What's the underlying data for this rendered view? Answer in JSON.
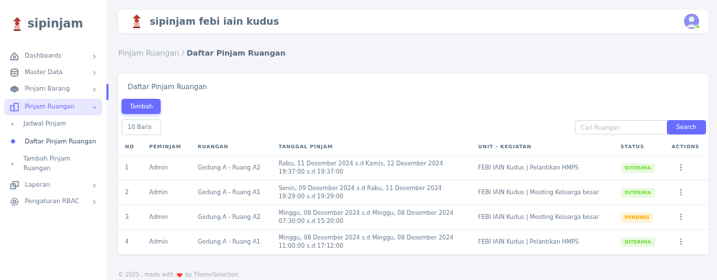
{
  "sidebar": {
    "brand": "sipinjam",
    "menu": [
      {
        "label": "Dashboards",
        "selected": false,
        "expanded": false
      },
      {
        "label": "Master Data",
        "selected": false,
        "expanded": false
      },
      {
        "label": "Pinjam Barang",
        "selected": false,
        "expanded": false
      },
      {
        "label": "Pinjam Ruangan",
        "selected": true,
        "expanded": true,
        "children": [
          {
            "label": "Jadwal Pinjam",
            "selected": false
          },
          {
            "label": "Daftar Pinjam Ruangan",
            "selected": true
          },
          {
            "label": "Tambah Pinjam Ruangan",
            "selected": false
          }
        ]
      },
      {
        "label": "Laporan",
        "selected": false,
        "expanded": false
      },
      {
        "label": "Pengaturan RBAC",
        "selected": false,
        "expanded": false
      }
    ]
  },
  "navbar": {
    "title": "sipinjam febi iain kudus",
    "avatar_online": true
  },
  "breadcrumb": {
    "parent": "Pinjam Ruangan /",
    "current": "Daftar Pinjam Ruangan"
  },
  "card": {
    "title": "Daftar Pinjam Ruangan",
    "add_button": "Tambah",
    "page_size": "10 Baris",
    "search": {
      "placeholder": "Cari Ruangan",
      "button": "Search"
    },
    "table": {
      "columns": [
        "NO",
        "PEMINJAM",
        "RUANGAN",
        "TANGGAL PINJAM",
        "UNIT - KEGIATAN",
        "STATUS",
        "ACTIONS"
      ],
      "rows": [
        {
          "no": "1",
          "peminjam": "Admin",
          "ruangan": "Gedung A - Ruang A2",
          "tanggal": [
            "Rabu, 11 Desember 2024 s.d Kamis, 12 Desember 2024",
            "19:37:00 s.d 19:37:00"
          ],
          "unit": "FEBI IAIN Kudus | Pelantikan HMPS",
          "status": {
            "label": "DITERIMA",
            "kind": "success"
          }
        },
        {
          "no": "2",
          "peminjam": "Admin",
          "ruangan": "Gedung A - Ruang A1",
          "tanggal": [
            "Senin, 09 Desember 2024 s.d Rabu, 11 Desember 2024",
            "19:29:00 s.d 19:29:00"
          ],
          "unit": "FEBI IAIN Kudus | Meeting Keluarga besar",
          "status": {
            "label": "DITERIMA",
            "kind": "success"
          }
        },
        {
          "no": "3",
          "peminjam": "Admin",
          "ruangan": "Gedung A - Ruang A2",
          "tanggal": [
            "Minggu, 08 Desember 2024 s.d Minggu, 08 Desember 2024",
            "07:30:00 s.d 15:20:00"
          ],
          "unit": "FEBI IAIN Kudus | Meeting Keluarga besar",
          "status": {
            "label": "PENDING",
            "kind": "warning"
          }
        },
        {
          "no": "4",
          "peminjam": "Admin",
          "ruangan": "Gedung A - Ruang A1",
          "tanggal": [
            "Minggu, 08 Desember 2024 s.d Minggu, 08 Desember 2024",
            "11:00:00 s.d 17:12:00"
          ],
          "unit": "FEBI IAIN Kudus | Pelantikan HMPS",
          "status": {
            "label": "DITERIMA",
            "kind": "success"
          }
        }
      ]
    }
  },
  "footer": {
    "before": "© 2025 , made with",
    "after": "by ThemeSelection"
  }
}
